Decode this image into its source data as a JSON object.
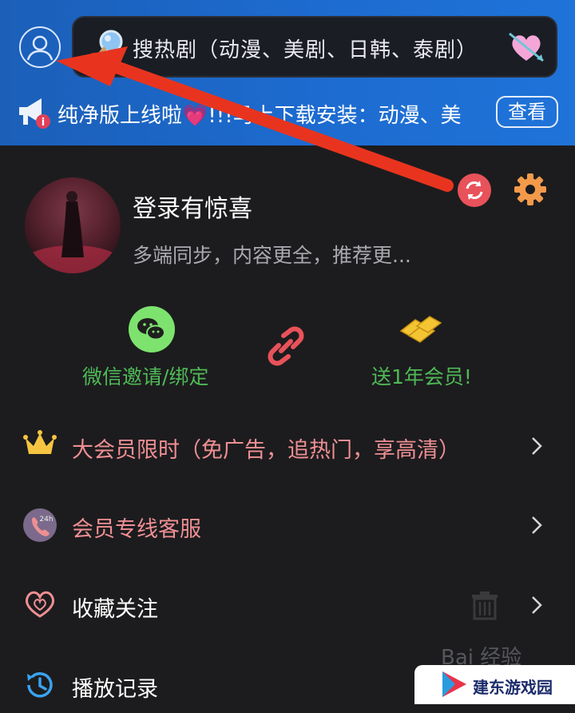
{
  "header": {
    "search_text": "搜热剧（动漫、美剧、日韩、泰剧）",
    "notice_text": "纯净版上线啦💗!!!马上下载安装：动漫、美",
    "view_label": "查看"
  },
  "profile": {
    "title": "登录有惊喜",
    "subtitle": "多端同步，内容更全，推荐更..."
  },
  "actions": {
    "wechat_label": "微信邀请/绑定",
    "gift_label": "送1年会员!"
  },
  "menu": [
    {
      "label": "大会员限时（免广告，追热门，享高清）"
    },
    {
      "label": "会员专线客服"
    },
    {
      "label": "收藏关注"
    },
    {
      "label": "播放记录"
    }
  ],
  "watermark": {
    "baidu": "Bai 经验",
    "site": "建东游戏园"
  },
  "colors": {
    "header_blue": "#1d6bd0",
    "background": "#1c1c1e",
    "accent_pink": "#ee8f93",
    "accent_green": "#4fb956",
    "arrow_red": "#e8341f"
  },
  "icons": [
    "user-icon",
    "search-icon",
    "heart-arrow-icon",
    "megaphone-icon",
    "sync-icon",
    "gear-icon",
    "wechat-icon",
    "link-icon",
    "gold-bars-icon",
    "crown-icon",
    "phone-24h-icon",
    "heart-icon",
    "trash-icon",
    "history-icon",
    "chevron-right-icon"
  ]
}
